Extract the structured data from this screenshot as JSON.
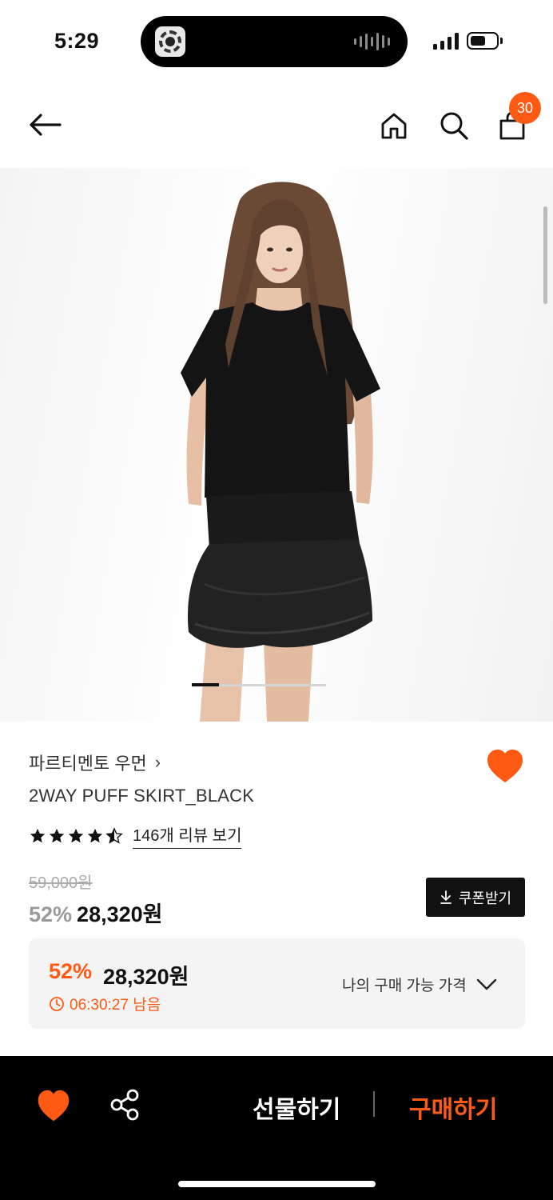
{
  "status_bar": {
    "time": "5:29"
  },
  "header": {
    "cart_badge": "30",
    "icons": [
      "back-arrow-icon",
      "home-icon",
      "search-icon",
      "shopping-bag-icon"
    ]
  },
  "product": {
    "image_page": "1",
    "image_pages_total": "5",
    "brand": "파르티멘토 우먼",
    "brand_chevron": "›",
    "name": "2WAY PUFF SKIRT_BLACK",
    "rating": 4.5,
    "review_link": "146개 리뷰 보기",
    "original_price": "59,000원",
    "discount": "52%",
    "sale_price": "28,320원",
    "coupon_button": "쿠폰받기"
  },
  "my_price": {
    "discount": "52%",
    "price": "28,320원",
    "timer": "06:30:27 남음",
    "label": "나의 구매 가능 가격"
  },
  "bottom_bar": {
    "gift_label": "선물하기",
    "buy_label": "구매하기"
  },
  "colors": {
    "accent": "#ff5a14",
    "dark": "#111111"
  }
}
